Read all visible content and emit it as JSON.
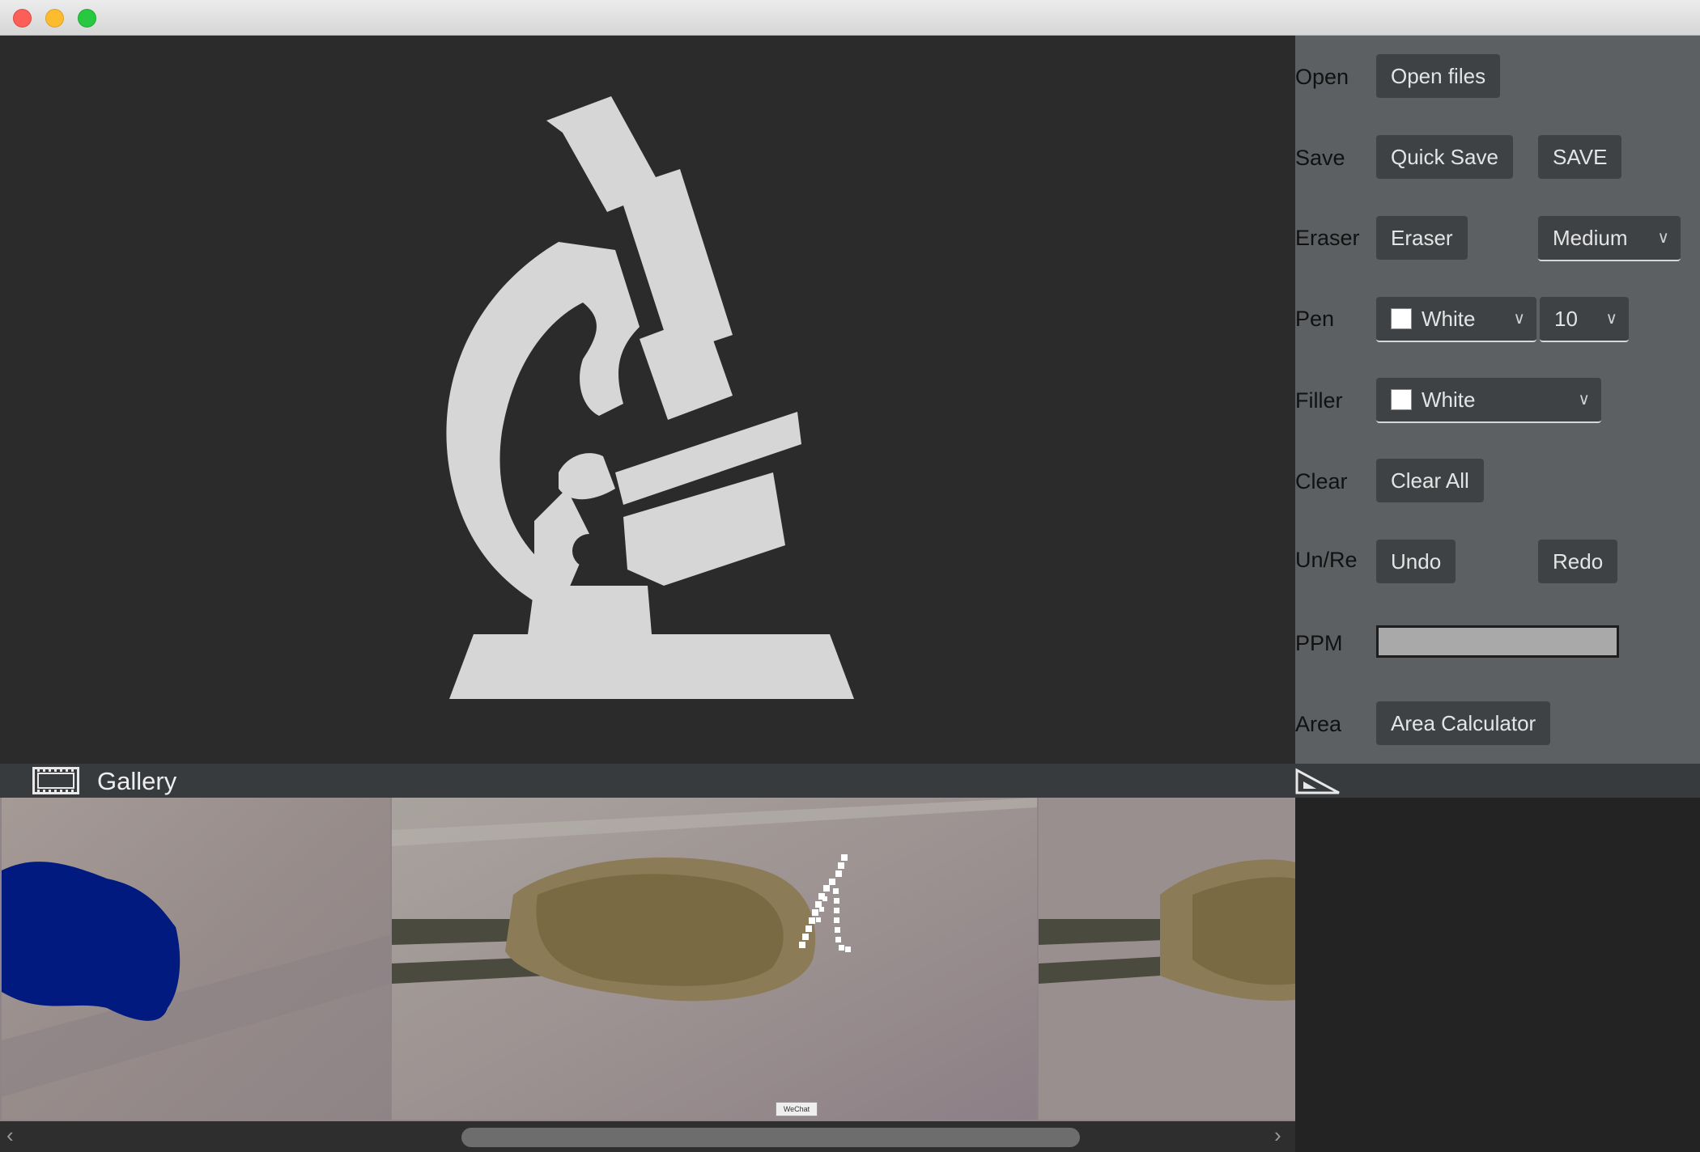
{
  "colors": {
    "canvas_bg": "#2b2b2b",
    "panel_bg": "#5c6063",
    "button_bg": "#3e4245",
    "icon_fill": "#d6d6d6",
    "mask_blue": "#001a80"
  },
  "toolbar": {
    "open": {
      "label": "Open",
      "button": "Open files"
    },
    "save": {
      "label": "Save",
      "quick_button": "Quick Save",
      "save_button": "SAVE"
    },
    "eraser": {
      "label": "Eraser",
      "button": "Eraser",
      "size_value": "Medium"
    },
    "pen": {
      "label": "Pen",
      "color_value": "White",
      "size_value": "10"
    },
    "filler": {
      "label": "Filler",
      "color_value": "White"
    },
    "clear": {
      "label": "Clear",
      "button": "Clear All"
    },
    "undo_redo": {
      "label": "Un/Re",
      "undo_button": "Undo",
      "redo_button": "Redo"
    },
    "ppm": {
      "label": "PPM",
      "value": ""
    },
    "area": {
      "label": "Area",
      "button": "Area Calculator"
    }
  },
  "gallery": {
    "title": "Gallery",
    "icon": "film-icon",
    "tooltip": "WeChat"
  },
  "canvas": {
    "placeholder_icon": "microscope-icon"
  }
}
